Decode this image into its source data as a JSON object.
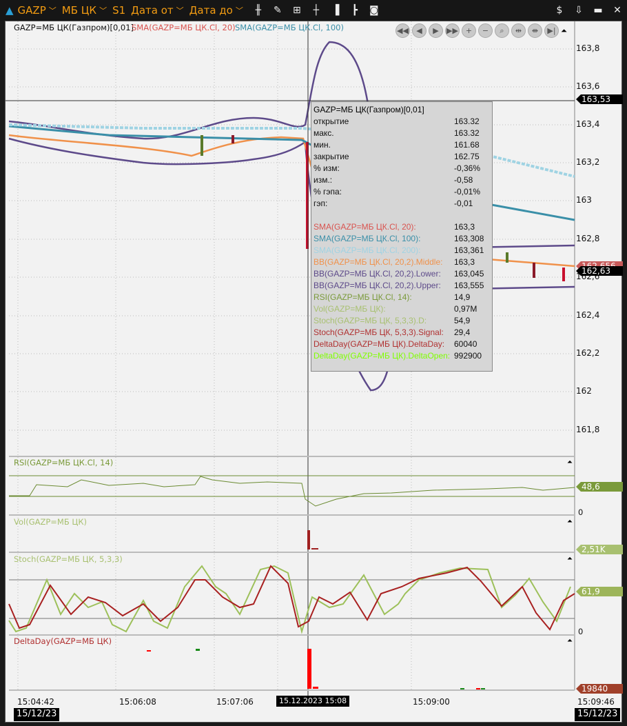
{
  "toolbar": {
    "symbol": "GAZP",
    "market": "МБ ЦК",
    "timeframe": "S1",
    "date_from": "Дата от",
    "date_to": "Дата до"
  },
  "legend": {
    "main": "GAZP=МБ ЦК(Газпром)[0,01]",
    "sma20": "SMA(GAZP=МБ ЦК.Cl, 20)",
    "sma100": "SMA(GAZP=МБ ЦК.Cl, 100)"
  },
  "price_axis": [
    "163,8",
    "163,6",
    "163,4",
    "163,2",
    "163",
    "162,8",
    "162,6",
    "162,4",
    "162,2",
    "162",
    "161,8"
  ],
  "price_tags": {
    "crosshair": "163,53",
    "sma": "162,656",
    "last": "162,63"
  },
  "tooltip": {
    "title": "GAZP=МБ ЦК(Газпром)[0,01]",
    "rows": [
      {
        "k": "открытие",
        "v": "163.32",
        "c": "#111"
      },
      {
        "k": "макс.",
        "v": "163.32",
        "c": "#111"
      },
      {
        "k": "мин.",
        "v": "161.68",
        "c": "#111"
      },
      {
        "k": "закрытие",
        "v": "162.75",
        "c": "#111"
      },
      {
        "k": "% изм:",
        "v": "-0,36%",
        "c": "#111"
      },
      {
        "k": "изм.:",
        "v": "-0,58",
        "c": "#111"
      },
      {
        "k": "% гэпа:",
        "v": "-0,01%",
        "c": "#111"
      },
      {
        "k": "гэп:",
        "v": "-0,01",
        "c": "#111"
      },
      {
        "k": "",
        "v": "",
        "c": "#111"
      },
      {
        "k": "SMA(GAZP=МБ ЦК.Cl, 20):",
        "v": "163,3",
        "c": "#d9534f"
      },
      {
        "k": "SMA(GAZP=МБ ЦК.Cl, 100):",
        "v": "163,308",
        "c": "#3a8fa8"
      },
      {
        "k": "SMA(GAZP=МБ ЦК.Cl, 200):",
        "v": "163,361",
        "c": "#9fd3e3"
      },
      {
        "k": "BB(GAZP=МБ ЦК.Cl, 20,2).Middle:",
        "v": "163,3",
        "c": "#f0914a"
      },
      {
        "k": "BB(GAZP=МБ ЦК.Cl, 20,2).Lower:",
        "v": "163,045",
        "c": "#5d4a8a"
      },
      {
        "k": "BB(GAZP=МБ ЦК.Cl, 20,2).Upper:",
        "v": "163,555",
        "c": "#5d4a8a"
      },
      {
        "k": "RSI(GAZP=МБ ЦК.Cl, 14):",
        "v": "14,9",
        "c": "#7a9a3a"
      },
      {
        "k": "Vol(GAZP=МБ ЦК):",
        "v": "0,97M",
        "c": "#a8c070"
      },
      {
        "k": "Stoch(GAZP=МБ ЦК, 5,3,3).D:",
        "v": "54,9",
        "c": "#a8c070"
      },
      {
        "k": "Stoch(GAZP=МБ ЦК, 5,3,3).Signal:",
        "v": "29,4",
        "c": "#b03030"
      },
      {
        "k": "DeltaDay(GAZP=МБ ЦК).DeltaDay:",
        "v": "60040",
        "c": "#b03030"
      },
      {
        "k": "DeltaDay(GAZP=МБ ЦК).DeltaOpen:",
        "v": "992900",
        "c": "#7fff00"
      }
    ]
  },
  "rsi": {
    "title": "RSI(GAZP=МБ ЦК.Cl, 14)",
    "value": "48,6",
    "zero": "0"
  },
  "vol": {
    "title": "Vol(GAZP=МБ ЦК)",
    "value": "2,51K"
  },
  "stoch": {
    "title": "Stoch(GAZP=МБ ЦК, 5,3,3)",
    "value": "61,9",
    "zero": "0"
  },
  "delta": {
    "title": "DeltaDay(GAZP=МБ ЦК)",
    "value": "19840"
  },
  "time_axis": [
    "15:04:42",
    "15:06:08",
    "15:07:06",
    "15:09:00",
    "15:09:46"
  ],
  "crosshair_time": "15.12.2023 15:08",
  "date_left": "15/12/23",
  "date_right": "15/12/23"
}
